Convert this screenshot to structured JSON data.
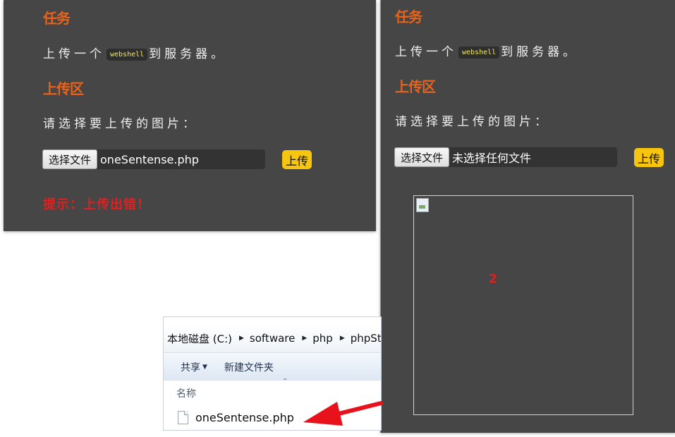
{
  "left": {
    "heading_task": "任务",
    "task_before": "上传一个",
    "task_code": "webshell",
    "task_after": "到服务器。",
    "heading_upload": "上传区",
    "prompt": "请选择要上传的图片：",
    "choose_button": "选择文件",
    "file_name": "oneSentense.php",
    "upload_button": "上传",
    "error": "提示：上传出错！"
  },
  "right": {
    "heading_task": "任务",
    "task_before": "上传一个",
    "task_code": "webshell",
    "task_after": "到服务器。",
    "heading_upload": "上传区",
    "prompt": "请选择要上传的图片：",
    "choose_button": "选择文件",
    "file_name": "未选择任何文件",
    "upload_button": "上传",
    "preview_marker": "2"
  },
  "explorer": {
    "breadcrumb": [
      "本地磁盘 (C:)",
      "software",
      "php",
      "phpSt"
    ],
    "toolbar": {
      "share": "共享",
      "new_folder": "新建文件夹"
    },
    "column_name": "名称",
    "file": "oneSentense.php"
  },
  "colors": {
    "panel_bg": "#464646",
    "heading": "#e8621a",
    "upload_button": "#f7c40e",
    "error": "#e02020",
    "code_text": "#f2e85a",
    "arrow": "#e8121c"
  },
  "icons": [
    "broken-image-icon",
    "file-icon",
    "dropdown-caret-icon",
    "breadcrumb-arrow-icon",
    "red-arrow-annotation"
  ]
}
